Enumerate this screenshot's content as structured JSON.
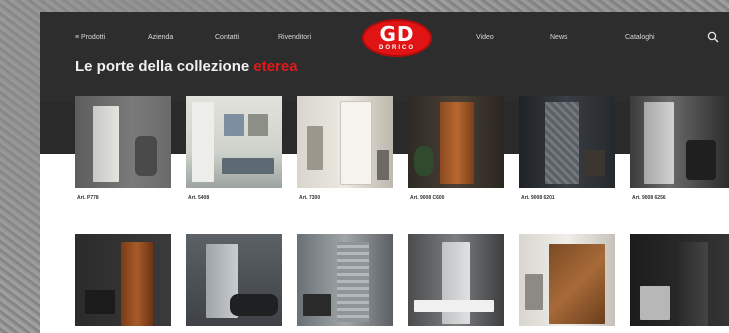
{
  "nav": {
    "prodotti": "≡ Prodotti",
    "azienda": "Azienda",
    "contatti": "Contatti",
    "rivenditori": "Rivenditori",
    "video": "Video",
    "news": "News",
    "cataloghi": "Cataloghi"
  },
  "logo": {
    "main": "GD",
    "sub": "DORICO"
  },
  "page": {
    "title": "Le porte della collezione ",
    "title_accent": "eterea"
  },
  "products_row1": [
    {
      "caption": "Art. P778"
    },
    {
      "caption": "Art. 5408"
    },
    {
      "caption": "Art. 7300"
    },
    {
      "caption": "Art. 9008 C600"
    },
    {
      "caption": "Art. 9008 6201"
    },
    {
      "caption": "Art. 9008 6256"
    }
  ],
  "products_row2": [
    {
      "caption": ""
    },
    {
      "caption": ""
    },
    {
      "caption": ""
    },
    {
      "caption": ""
    },
    {
      "caption": ""
    },
    {
      "caption": ""
    }
  ],
  "colors": {
    "header": "#2d2d2d",
    "accent": "#e01a1a",
    "logo": "#e01414"
  }
}
